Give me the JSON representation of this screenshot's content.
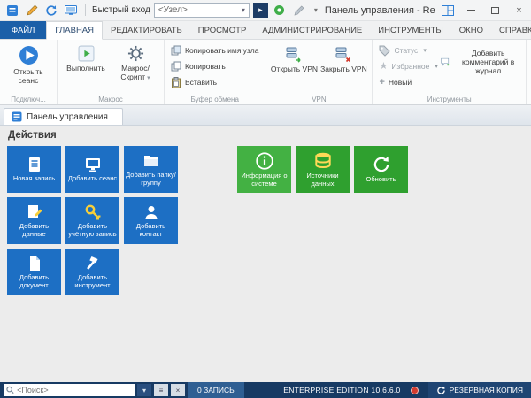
{
  "glyphs": {
    "caret_down": "▾",
    "go_arrow": "▸",
    "close": "×",
    "list": "≡",
    "star": "★",
    "plus": "+"
  },
  "titlebar": {
    "quick_label": "Быстрый вход",
    "node_value": "<Узел>",
    "title": "Панель управления - Remote Desktop..."
  },
  "ribbon": {
    "tabs": [
      "ФАЙЛ",
      "ГЛАВНАЯ",
      "РЕДАКТИРОВАТЬ",
      "ПРОСМОТР",
      "АДМИНИСТРИРОВАНИЕ",
      "ИНСТРУМЕНТЫ",
      "ОКНО",
      "СПРАВКА"
    ],
    "active_tab": "ГЛАВНАЯ",
    "groups": {
      "connection": {
        "caption": "Подключ...",
        "open_session": "Открыть сеанс"
      },
      "macro": {
        "caption": "Макрос",
        "run": "Выполнить",
        "script": "Макрос/Скрипт"
      },
      "clipboard": {
        "caption": "Буфер обмена",
        "copy_host": "Копировать имя узла",
        "copy": "Копировать",
        "paste": "Вставить"
      },
      "vpn": {
        "caption": "VPN",
        "open_vpn": "Открыть VPN",
        "close_vpn": "Закрыть VPN"
      },
      "tools": {
        "caption": "Инструменты",
        "status": "Статус",
        "favorites": "Избранное",
        "new": "Новый",
        "add_comment": "Добавить комментарий в журнал"
      }
    }
  },
  "doc_tab": {
    "label": "Панель управления"
  },
  "content": {
    "section_title": "Действия",
    "tiles": [
      {
        "label": "Новая запись",
        "icon": "new-entry-icon"
      },
      {
        "label": "Добавить сеанс",
        "icon": "add-session-icon"
      },
      {
        "label": "Добавить папку/группу",
        "icon": "add-folder-icon"
      },
      {
        "label": "Добавить данные",
        "icon": "add-data-icon"
      },
      {
        "label": "Добавить учётную запись",
        "icon": "add-credential-icon"
      },
      {
        "label": "Добавить контакт",
        "icon": "add-contact-icon"
      },
      {
        "label": "Добавить документ",
        "icon": "add-document-icon"
      },
      {
        "label": "Добавить инструмент",
        "icon": "add-tool-icon"
      },
      {
        "label": "Информация о системе",
        "icon": "information-icon"
      },
      {
        "label": "Источники данных",
        "icon": "data-sources-icon"
      },
      {
        "label": "Обновить",
        "icon": "refresh-icon"
      }
    ]
  },
  "statusbar": {
    "search_placeholder": "<Поиск>",
    "records_count": "0 ЗАПИСЬ",
    "edition": "ENTERPRISE EDITION 10.6.6.0",
    "backup_label": "РЕЗЕРВНАЯ КОПИЯ"
  },
  "colors": {
    "tile_blue": "#1d6fc4",
    "tile_green": "#2fa02f",
    "tile_green_light": "#43b143",
    "file_tab_blue": "#1b5fa8",
    "statusbar_navy": "#173a63",
    "records_badge_blue": "#2f5f93",
    "alert_red": "#d23b2f",
    "key_yellow": "#f8cf3a"
  }
}
